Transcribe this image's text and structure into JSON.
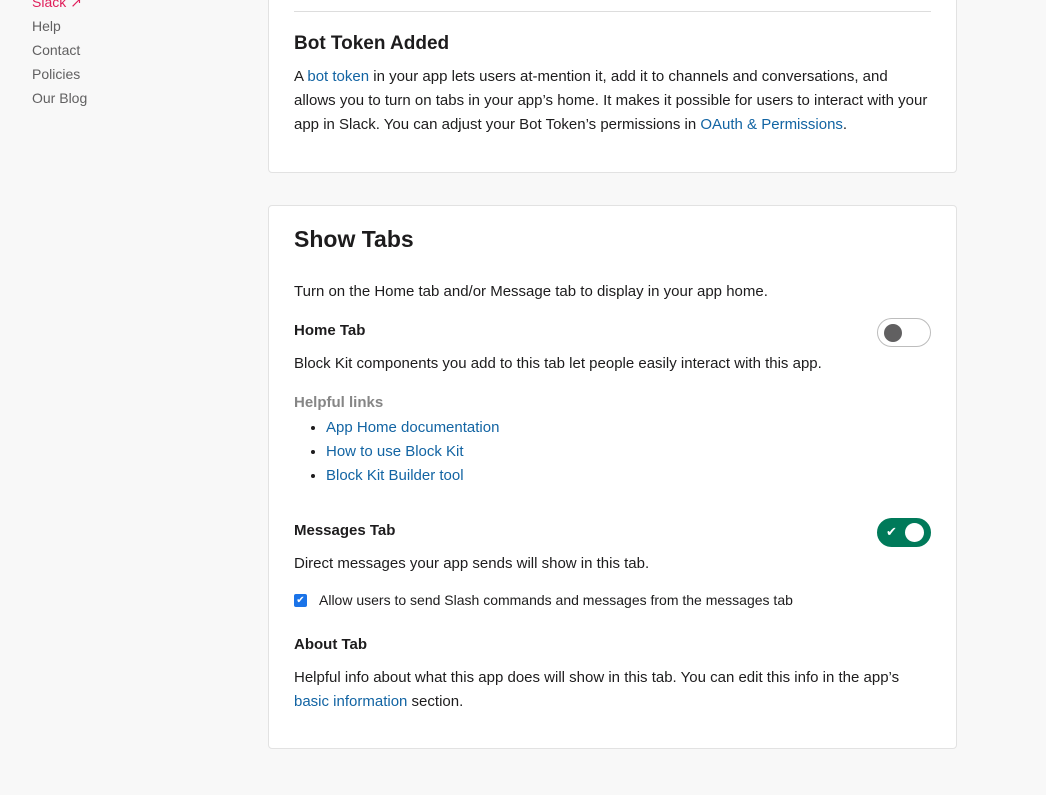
{
  "sidebar": {
    "items": [
      {
        "label": "Slack ↗"
      },
      {
        "label": "Help"
      },
      {
        "label": "Contact"
      },
      {
        "label": "Policies"
      },
      {
        "label": "Our Blog"
      }
    ]
  },
  "bot_token": {
    "title": "Bot Token Added",
    "text_a": "A ",
    "link1": "bot token",
    "text_b": " in your app lets users at-mention it, add it to channels and conversations, and allows you to turn on tabs in your app’s home. It makes it possible for users to interact with your app in Slack. You can adjust your Bot Token’s permissions in ",
    "link2": "OAuth & Permissions",
    "text_c": "."
  },
  "show_tabs": {
    "title": "Show Tabs",
    "intro": "Turn on the Home tab and/or Message tab to display in your app home.",
    "home": {
      "label": "Home Tab",
      "description": "Block Kit components you add to this tab let people easily interact with this app.",
      "enabled": false,
      "helpful_heading": "Helpful links",
      "links": [
        "App Home documentation",
        "How to use Block Kit",
        "Block Kit Builder tool"
      ]
    },
    "messages": {
      "label": "Messages Tab",
      "description": "Direct messages your app sends will show in this tab.",
      "enabled": true,
      "check_icon": "✔",
      "checkbox_label": "Allow users to send Slash commands and messages from the messages tab",
      "checkbox_checked": true
    },
    "about": {
      "label": "About Tab",
      "text_a": "Helpful info about what this app does will show in this tab. You can edit this info in the app’s ",
      "link": "basic information",
      "text_b": " section."
    }
  }
}
